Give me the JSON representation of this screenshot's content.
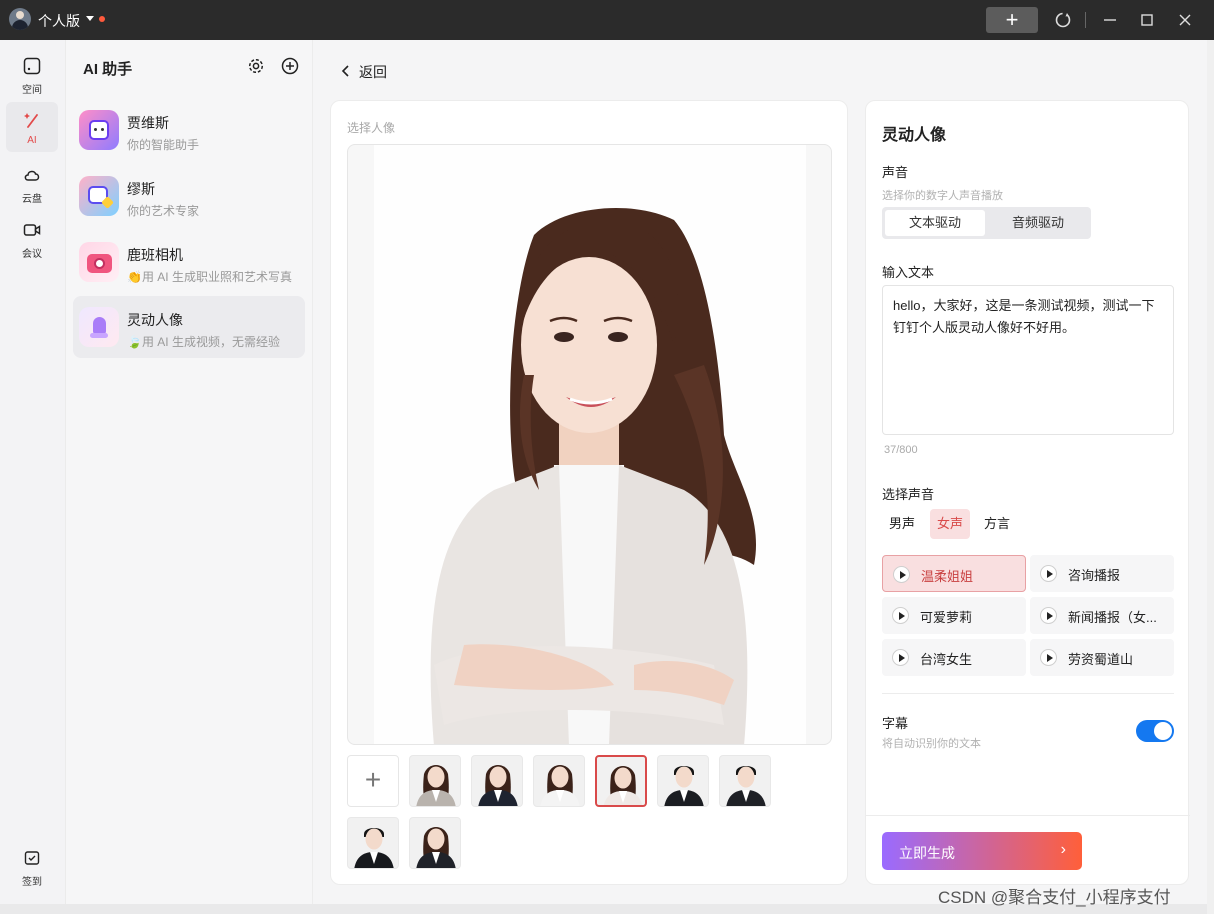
{
  "titlebar": {
    "account_name": "个人版",
    "new_icon": "plus-icon",
    "colors": {
      "bg": "#2b2b2b",
      "notify_dot": "#ff5a3c"
    }
  },
  "nav": {
    "items": [
      {
        "label": "空间",
        "icon": "space-icon"
      },
      {
        "label": "AI",
        "icon": "ai-wand-icon",
        "active": true
      },
      {
        "label": "云盘",
        "icon": "cloud-icon"
      },
      {
        "label": "会议",
        "icon": "video-camera-icon"
      }
    ],
    "bottom": {
      "label": "签到",
      "icon": "checkin-icon"
    }
  },
  "panel": {
    "title": "AI 助手",
    "assistants": [
      {
        "name": "贾维斯",
        "desc": "你的智能助手"
      },
      {
        "name": "缪斯",
        "desc": "你的艺术专家"
      },
      {
        "name": "鹿班相机",
        "desc": "👏用 AI 生成职业照和艺术写真"
      },
      {
        "name": "灵动人像",
        "desc": "🍃用 AI 生成视频，无需经验",
        "active": true
      }
    ]
  },
  "main": {
    "back_label": "返回",
    "portrait": {
      "caption": "选择人像",
      "thumbnails": [
        {
          "kind": "add"
        },
        {
          "kind": "female",
          "outfit": "#b9b3ad"
        },
        {
          "kind": "female",
          "outfit": "#1e2330"
        },
        {
          "kind": "female",
          "outfit": "#f4f4f4"
        },
        {
          "kind": "female",
          "outfit": "#efe9e6",
          "selected": true
        },
        {
          "kind": "male",
          "outfit": "#1b1d22"
        },
        {
          "kind": "male",
          "outfit": "#1f2126"
        },
        {
          "kind": "male",
          "outfit": "#17191d"
        },
        {
          "kind": "female",
          "outfit": "#202229"
        }
      ]
    },
    "settings": {
      "title": "灵动人像",
      "voice_label": "声音",
      "voice_hint": "选择你的数字人声音播放",
      "drive_tabs": [
        "文本驱动",
        "音频驱动"
      ],
      "input_label": "输入文本",
      "input_text": "hello，大家好，这是一条测试视频，测试一下钉钉个人版灵动人像好不好用。",
      "counter": "37/800",
      "select_voice_label": "选择声音",
      "voice_tabs": [
        "男声",
        "女声",
        "方言"
      ],
      "voices": [
        "温柔姐姐",
        "咨询播报",
        "可爱萝莉",
        "新闻播报（女...",
        "台湾女生",
        "劳资蜀道山"
      ],
      "subtitle_label": "字幕",
      "subtitle_hint": "将自动识别你的文本",
      "subtitle_on": true,
      "generate_label": "立即生成",
      "colors": {
        "accent_red": "#d94a4a",
        "toggle": "#1478f0",
        "gradient_start": "#9a6bff",
        "gradient_end": "#ff5f3a"
      }
    }
  },
  "watermark": "CSDN @聚合支付_小程序支付"
}
